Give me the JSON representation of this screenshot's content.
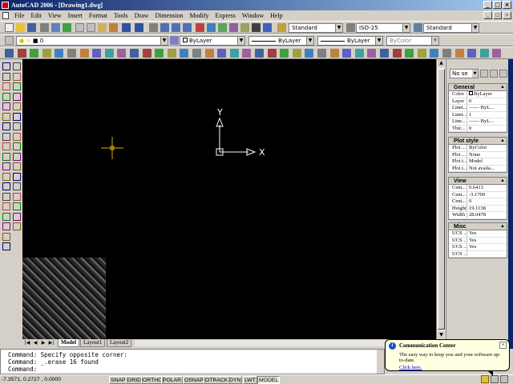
{
  "window": {
    "title": "AutoCAD 2006 - [Drawing1.dwg]",
    "controls": [
      "_",
      "□",
      "×"
    ]
  },
  "menu": {
    "items": [
      "File",
      "Edit",
      "View",
      "Insert",
      "Format",
      "Tools",
      "Draw",
      "Dimension",
      "Modify",
      "Express",
      "Window",
      "Help"
    ],
    "doc_controls": [
      "_",
      "□",
      "×"
    ]
  },
  "toolbar": {
    "text_style": "Standard",
    "dim_style": "ISO-25",
    "table_style": "Standard",
    "layer": "0",
    "color": "ByLayer",
    "linetype": "ByLayer",
    "lineweight": "ByLayer",
    "plotstyle": "ByColor"
  },
  "canvas": {
    "ucs_y_label": "Y",
    "ucs_x_label": "X"
  },
  "layout_tabs": {
    "nav": [
      "|◀",
      "◀",
      "▶",
      "▶|"
    ],
    "tabs": [
      "Model",
      "Layout1",
      "Layout2"
    ]
  },
  "properties": {
    "selection": "No se",
    "general": {
      "title": "General",
      "rows": [
        {
          "k": "Color",
          "v": "ByLayer"
        },
        {
          "k": "Layer",
          "v": "0"
        },
        {
          "k": "Linet...",
          "v": "—— ByL..."
        },
        {
          "k": "Linet...",
          "v": "1"
        },
        {
          "k": "Line...",
          "v": "—— ByL..."
        },
        {
          "k": "Thic...",
          "v": "0"
        }
      ]
    },
    "plot_style": {
      "title": "Plot style",
      "rows": [
        {
          "k": "Plot ...",
          "v": "ByColor"
        },
        {
          "k": "Plot ...",
          "v": "None"
        },
        {
          "k": "Plot t...",
          "v": "Model"
        },
        {
          "k": "Plot t...",
          "v": "Not availa..."
        }
      ]
    },
    "view": {
      "title": "View",
      "rows": [
        {
          "k": "Cent...",
          "v": "0.6413"
        },
        {
          "k": "Cent...",
          "v": "-3.1709"
        },
        {
          "k": "Cent...",
          "v": "0"
        },
        {
          "k": "Height",
          "v": "19.1138"
        },
        {
          "k": "Width",
          "v": "28.0478"
        }
      ]
    },
    "misc": {
      "title": "Misc",
      "rows": [
        {
          "k": "UCS ...",
          "v": "Yes"
        },
        {
          "k": "UCS ...",
          "v": "Yes"
        },
        {
          "k": "UCS ...",
          "v": "Yes"
        },
        {
          "k": "UCS ...",
          "v": ""
        }
      ]
    }
  },
  "command": {
    "line1": "Command: Specify opposite corner:",
    "line2": "Command: _.erase 16 found",
    "line3": "Command:"
  },
  "status": {
    "coords": "-7.3571, 0.2727 , 0.0000",
    "buttons": [
      "SNAP",
      "GRID",
      "ORTHO",
      "POLAR",
      "OSNAP",
      "OTRACK",
      "DYN",
      "LWT",
      "MODEL"
    ]
  },
  "balloon": {
    "title": "Communication Center",
    "text": "The easy way to keep you and your software up-to-date.",
    "link": "Click here."
  },
  "colors": {
    "titlebar": "#0a246a",
    "canvas": "#000000",
    "crosshair": "#d4b000",
    "ucs": "#ffffff"
  }
}
